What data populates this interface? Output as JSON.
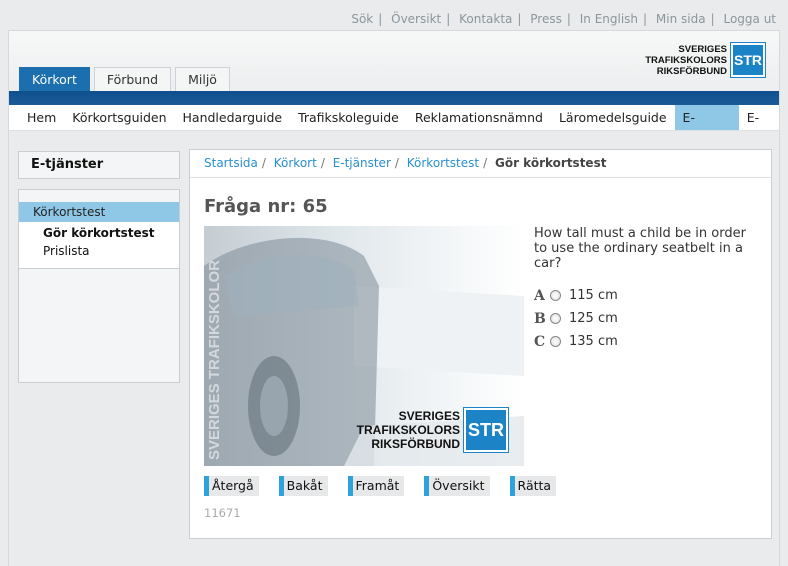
{
  "top_links": [
    "Sök",
    "Översikt",
    "Kontakta",
    "Press",
    "In English",
    "Min sida",
    "Logga ut"
  ],
  "logo": {
    "line1": "SVERIGES",
    "line2": "TRAFIKSKOLORS",
    "line3": "RIKSFÖRBUND",
    "mark": "STR"
  },
  "tabs": [
    {
      "label": "Körkort"
    },
    {
      "label": "Förbund"
    },
    {
      "label": "Miljö"
    }
  ],
  "nav": [
    {
      "label": "Hem"
    },
    {
      "label": "Körkortsguiden"
    },
    {
      "label": "Handledarguide"
    },
    {
      "label": "Trafikskoleguide"
    },
    {
      "label": "Reklamationsnämnd"
    },
    {
      "label": "Läromedelsguide"
    },
    {
      "label": "E-tjänster"
    },
    {
      "label": "E-butik"
    }
  ],
  "sidebar": {
    "title": "E-tjänster",
    "selected": "Körkortstest",
    "sub_items": [
      {
        "label": "Gör körkortstest"
      },
      {
        "label": "Prislista"
      }
    ]
  },
  "breadcrumb": [
    "Startsida",
    "Körkort",
    "E-tjänster",
    "Körkortstest",
    "Gör körkortstest"
  ],
  "question": {
    "number_label": "Fråga nr: 65",
    "text": "How tall must a child be in order to use the ordinary seatbelt in a car?",
    "options": [
      {
        "letter": "A",
        "text": "115 cm"
      },
      {
        "letter": "B",
        "text": "125 cm"
      },
      {
        "letter": "C",
        "text": "135 cm"
      }
    ],
    "image": {
      "watermark": "SVERIGES TRAFIKSKOLOR",
      "logo_line1": "SVERIGES",
      "logo_line2": "TRAFIKSKOLORS",
      "logo_line3": "RIKSFÖRBUND",
      "logo_mark": "STR"
    }
  },
  "buttons": [
    {
      "label": "Återgå"
    },
    {
      "label": "Bakåt"
    },
    {
      "label": "Framåt"
    },
    {
      "label": "Översikt"
    },
    {
      "label": "Rätta"
    }
  ],
  "code": "11671",
  "colors": {
    "accent": "#1c6fae",
    "highlight": "#8fc8e6",
    "link": "#2a8fcf"
  }
}
